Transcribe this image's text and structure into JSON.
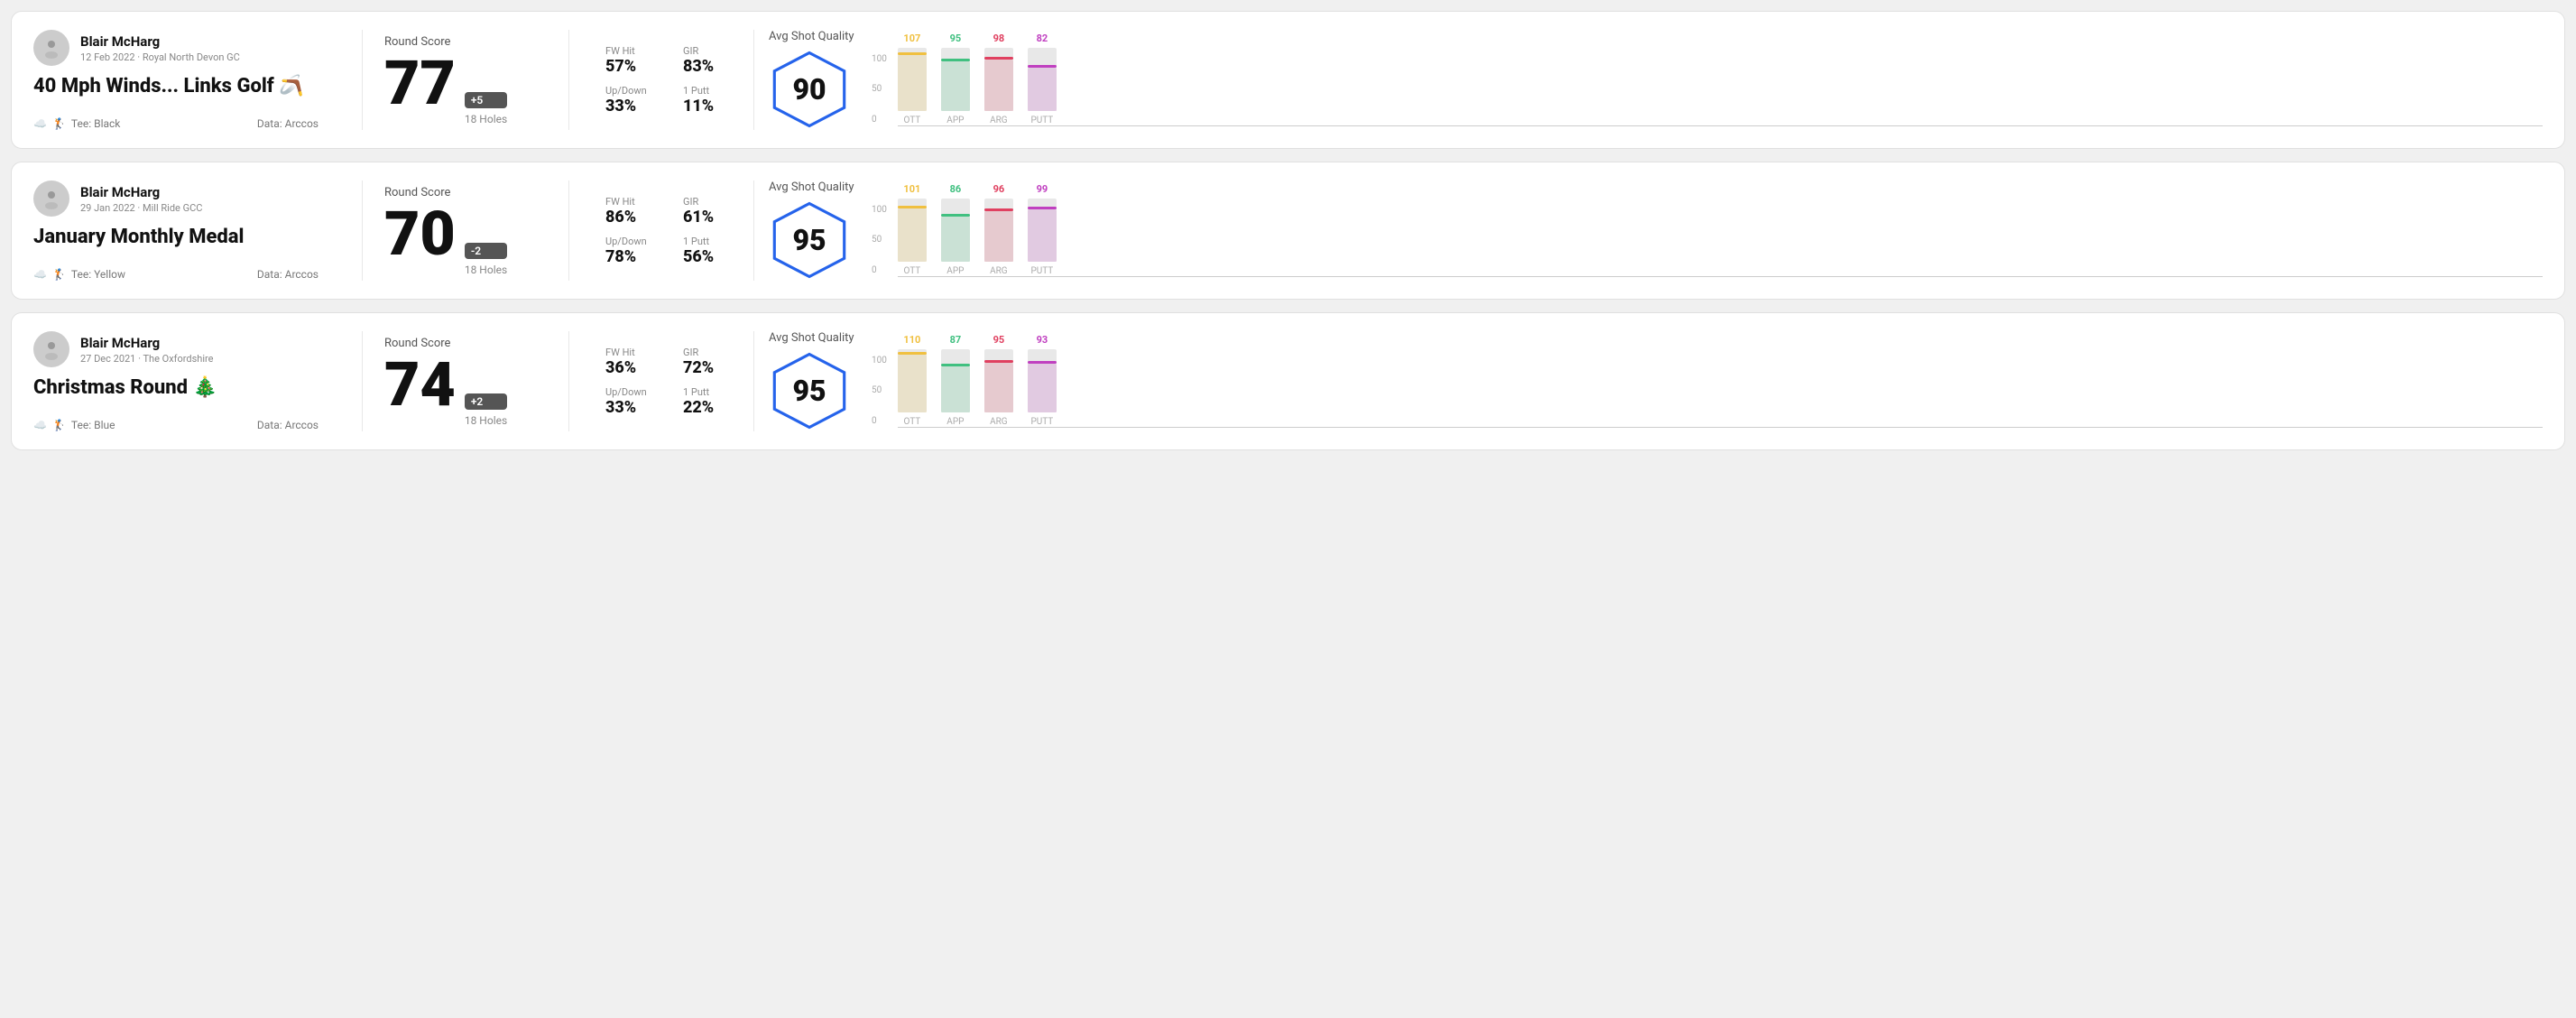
{
  "rounds": [
    {
      "id": "round1",
      "player_name": "Blair McHarg",
      "date_venue": "12 Feb 2022 · Royal North Devon GC",
      "title": "40 Mph Winds... Links Golf 🪃",
      "tee": "Black",
      "data_source": "Data: Arccos",
      "round_score_label": "Round Score",
      "score": "77",
      "score_diff": "+5",
      "holes": "18 Holes",
      "fw_hit_label": "FW Hit",
      "fw_hit": "57%",
      "gir_label": "GIR",
      "gir": "83%",
      "updown_label": "Up/Down",
      "updown": "33%",
      "oneputt_label": "1 Putt",
      "oneputt": "11%",
      "avg_quality_label": "Avg Shot Quality",
      "quality_score": "90",
      "bars": [
        {
          "label": "OTT",
          "value": 107,
          "color": "#f0c040",
          "max": 120
        },
        {
          "label": "APP",
          "value": 95,
          "color": "#40c080",
          "max": 120
        },
        {
          "label": "ARG",
          "value": 98,
          "color": "#e04060",
          "max": 120
        },
        {
          "label": "PUTT",
          "value": 82,
          "color": "#c040c0",
          "max": 120
        }
      ]
    },
    {
      "id": "round2",
      "player_name": "Blair McHarg",
      "date_venue": "29 Jan 2022 · Mill Ride GCC",
      "title": "January Monthly Medal",
      "tee": "Yellow",
      "data_source": "Data: Arccos",
      "round_score_label": "Round Score",
      "score": "70",
      "score_diff": "-2",
      "holes": "18 Holes",
      "fw_hit_label": "FW Hit",
      "fw_hit": "86%",
      "gir_label": "GIR",
      "gir": "61%",
      "updown_label": "Up/Down",
      "updown": "78%",
      "oneputt_label": "1 Putt",
      "oneputt": "56%",
      "avg_quality_label": "Avg Shot Quality",
      "quality_score": "95",
      "bars": [
        {
          "label": "OTT",
          "value": 101,
          "color": "#f0c040",
          "max": 120
        },
        {
          "label": "APP",
          "value": 86,
          "color": "#40c080",
          "max": 120
        },
        {
          "label": "ARG",
          "value": 96,
          "color": "#e04060",
          "max": 120
        },
        {
          "label": "PUTT",
          "value": 99,
          "color": "#c040c0",
          "max": 120
        }
      ]
    },
    {
      "id": "round3",
      "player_name": "Blair McHarg",
      "date_venue": "27 Dec 2021 · The Oxfordshire",
      "title": "Christmas Round 🎄",
      "tee": "Blue",
      "data_source": "Data: Arccos",
      "round_score_label": "Round Score",
      "score": "74",
      "score_diff": "+2",
      "holes": "18 Holes",
      "fw_hit_label": "FW Hit",
      "fw_hit": "36%",
      "gir_label": "GIR",
      "gir": "72%",
      "updown_label": "Up/Down",
      "updown": "33%",
      "oneputt_label": "1 Putt",
      "oneputt": "22%",
      "avg_quality_label": "Avg Shot Quality",
      "quality_score": "95",
      "bars": [
        {
          "label": "OTT",
          "value": 110,
          "color": "#f0c040",
          "max": 120
        },
        {
          "label": "APP",
          "value": 87,
          "color": "#40c080",
          "max": 120
        },
        {
          "label": "ARG",
          "value": 95,
          "color": "#e04060",
          "max": 120
        },
        {
          "label": "PUTT",
          "value": 93,
          "color": "#c040c0",
          "max": 120
        }
      ]
    }
  ]
}
